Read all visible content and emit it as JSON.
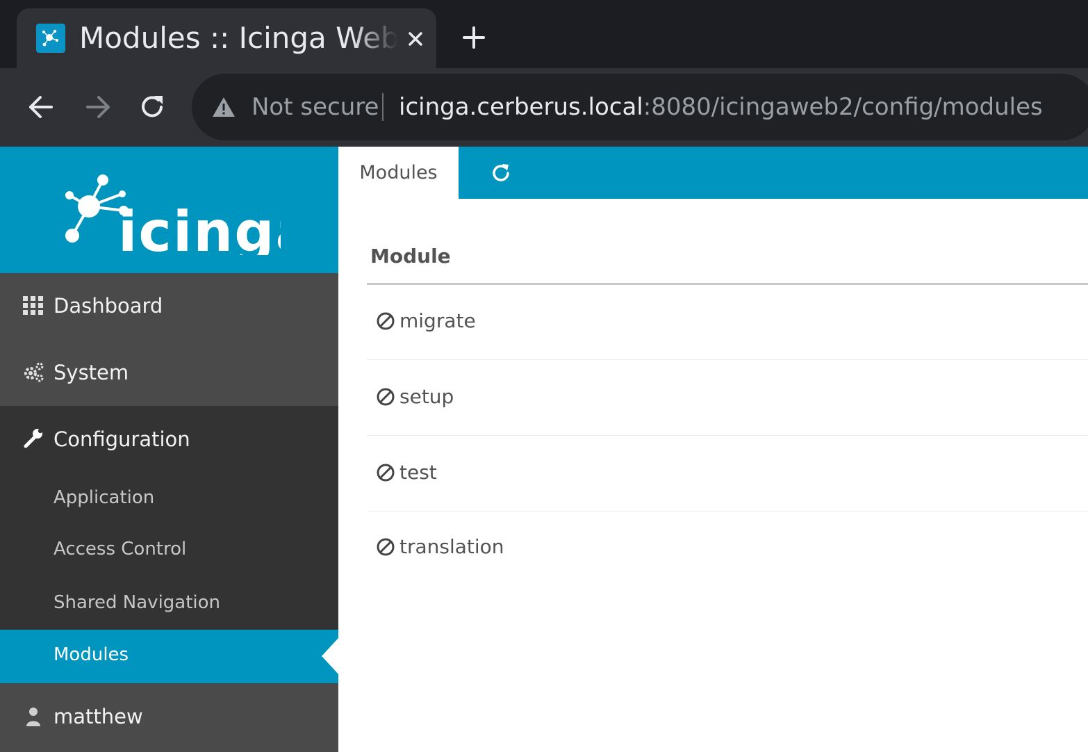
{
  "browser": {
    "tab_title": "Modules :: Icinga Web",
    "security_label": "Not secure",
    "url_host": "icinga.cerberus.local",
    "url_rest": ":8080/icingaweb2/config/modules"
  },
  "sidebar": {
    "logo_text": "icinga",
    "menu": [
      {
        "label": "Dashboard",
        "icon": "dashboard-grid-icon"
      },
      {
        "label": "System",
        "icon": "gears-icon"
      },
      {
        "label": "Configuration",
        "icon": "wrench-icon"
      }
    ],
    "config_submenu": [
      {
        "label": "Application"
      },
      {
        "label": "Access Control"
      },
      {
        "label": "Shared Navigation"
      },
      {
        "label": "Modules",
        "active": true
      }
    ],
    "user": {
      "label": "matthew",
      "icon": "user-icon"
    }
  },
  "main": {
    "tabs": [
      {
        "label": "Modules",
        "active": true
      }
    ],
    "table": {
      "header": "Module",
      "rows": [
        {
          "name": "migrate",
          "status_icon": "disabled-icon"
        },
        {
          "name": "setup",
          "status_icon": "disabled-icon"
        },
        {
          "name": "test",
          "status_icon": "disabled-icon"
        },
        {
          "name": "translation",
          "status_icon": "disabled-icon"
        }
      ]
    }
  },
  "colors": {
    "icinga_blue": "#0095bf",
    "sidebar_dark": "#333333",
    "sidebar_light": "#4a4a4a",
    "browser_dark": "#1c1d22"
  }
}
